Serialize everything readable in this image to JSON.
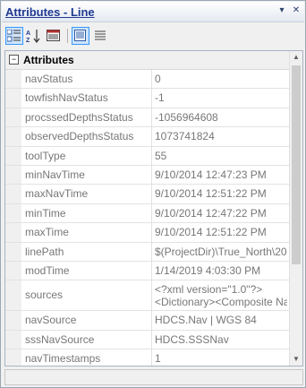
{
  "window": {
    "title": "Attributes - Line",
    "pin_glyph": "▾",
    "close_glyph": "✕"
  },
  "toolbar": {
    "buttons": [
      {
        "name": "categorized-view-icon",
        "active": true
      },
      {
        "name": "alphabetical-sort-icon",
        "active": false
      },
      {
        "name": "property-pages-icon",
        "active": false
      },
      {
        "name": "show-description-icon",
        "active": true
      },
      {
        "name": "list-view-icon",
        "active": false
      }
    ],
    "sort_label": "A Z"
  },
  "category": {
    "toggle": "−",
    "label": "Attributes"
  },
  "properties": [
    {
      "name": "navStatus",
      "value": "0"
    },
    {
      "name": "towfishNavStatus",
      "value": "-1"
    },
    {
      "name": "procssedDepthsStatus",
      "value": "-1056964608"
    },
    {
      "name": "observedDepthsStatus",
      "value": "1073741824"
    },
    {
      "name": "toolType",
      "value": "55"
    },
    {
      "name": "minNavTime",
      "value": "9/10/2014 12:47:23 PM"
    },
    {
      "name": "maxNavTime",
      "value": "9/10/2014 12:51:22 PM"
    },
    {
      "name": "minTime",
      "value": "9/10/2014 12:47:22 PM"
    },
    {
      "name": "maxTime",
      "value": "9/10/2014 12:51:22 PM"
    },
    {
      "name": "linePath",
      "value": "$(ProjectDir)\\True_North\\20"
    },
    {
      "name": "modTime",
      "value": "1/14/2019 4:03:30 PM"
    },
    {
      "name": "sources",
      "value": "<?xml version=\"1.0\"?>\n<Dictionary><Composite Na",
      "multiline": true
    },
    {
      "name": "navSource",
      "value": "HDCS.Nav | WGS 84"
    },
    {
      "name": "sssNavSource",
      "value": "HDCS.SSSNav"
    },
    {
      "name": "navTimestamps",
      "value": "1"
    }
  ],
  "scrollbar": {
    "up_glyph": "▲",
    "down_glyph": "▼"
  },
  "colors": {
    "title_text": "#1f3a93",
    "selection": "#cfe3fa",
    "grid_text": "#777777"
  }
}
